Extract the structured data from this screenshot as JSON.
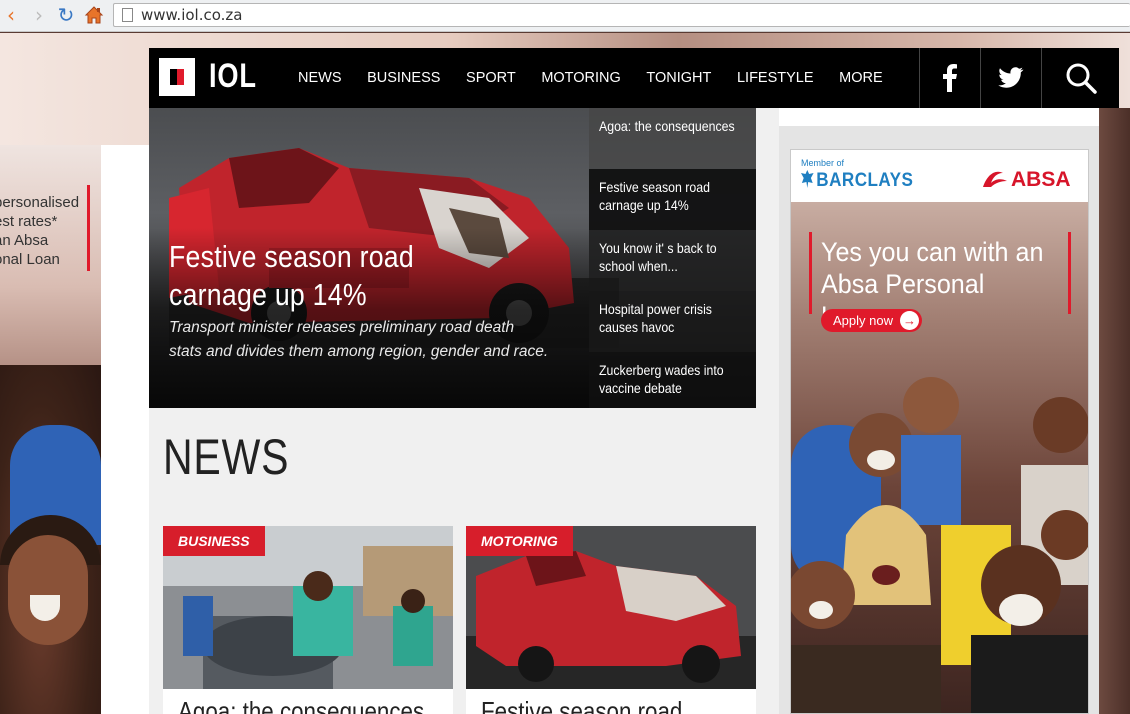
{
  "browser": {
    "url": "www.iol.co.za",
    "back_icon": "back-arrow-icon",
    "forward_icon": "forward-arrow-icon",
    "reload_icon": "reload-icon",
    "home_icon": "home-icon"
  },
  "left_ad": {
    "lines": [
      "personalised",
      "est rates*",
      "an Absa",
      "onal Loan"
    ]
  },
  "header": {
    "logo": "IOL",
    "menu": [
      "NEWS",
      "BUSINESS",
      "SPORT",
      "MOTORING",
      "TONIGHT",
      "LIFESTYLE",
      "MORE"
    ],
    "social": [
      "facebook-icon",
      "twitter-icon",
      "search-icon"
    ]
  },
  "hero": {
    "title": "Festive season road carnage up 14%",
    "subtitle": "Transport minister releases preliminary road death stats and divides them among region, gender and race.",
    "list": [
      "Agoa: the consequences",
      "Festive season road carnage up 14%",
      "You know it' s back to school when...",
      "Hospital power crisis causes havoc",
      "Zuckerberg wades into vaccine debate"
    ]
  },
  "news": {
    "heading": "NEWS",
    "cards": [
      {
        "tag": "BUSINESS",
        "title": "Agoa: the consequences"
      },
      {
        "tag": "MOTORING",
        "title": "Festive season road"
      }
    ]
  },
  "ad": {
    "member_of": "Member of",
    "barclays": "BARCLAYS",
    "absa": "ABSA",
    "headline": "Yes you can with an Absa Personal Loan",
    "cta": "Apply now"
  },
  "colors": {
    "accent": "#d71e2b",
    "header_bg": "#000000",
    "link_blue": "#1f7fc1"
  }
}
